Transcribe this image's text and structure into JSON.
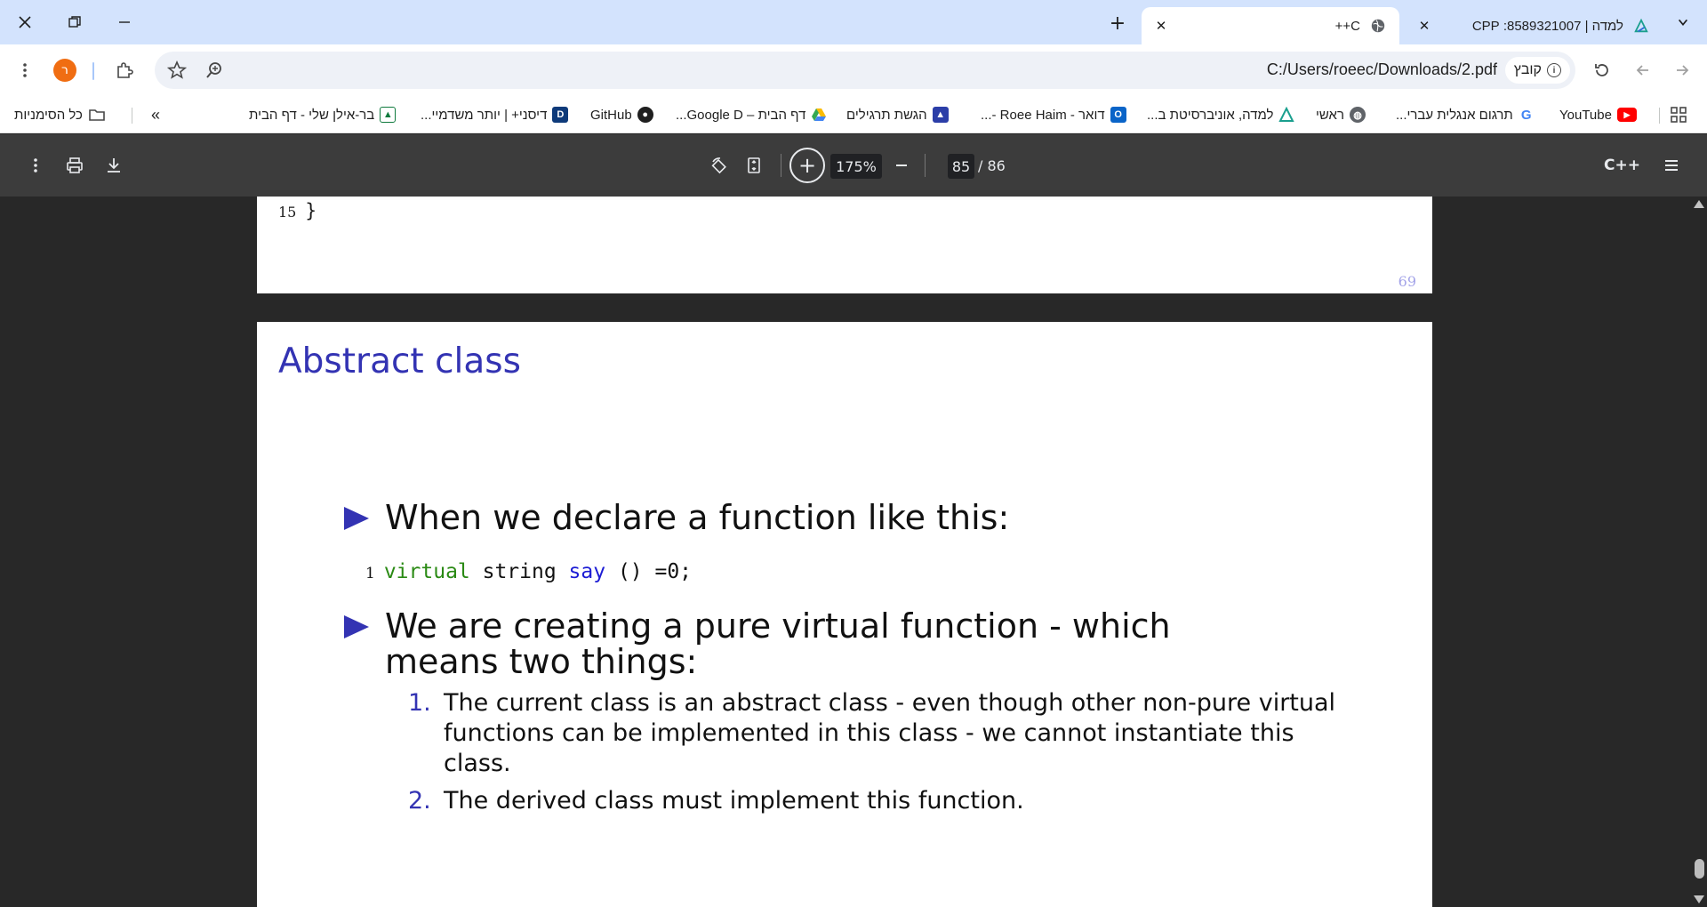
{
  "tabs": [
    {
      "title": "C++",
      "active": true,
      "icon": "globe-icon"
    },
    {
      "title": "למדה | 8589321007: CPP",
      "active": false,
      "icon": "lemida-logo-icon"
    }
  ],
  "toolbar": {
    "profile_initial": "ר",
    "url": "C:/Users/roeec/Downloads/2.pdf",
    "file_chip_label": "קובץ"
  },
  "bookmarks": [
    {
      "label": "YouTube",
      "icon": "youtube-icon",
      "color": "#ff0000"
    },
    {
      "label": "תרגום אנגלית עברי...",
      "icon": "google-icon",
      "color": "#4285f4"
    },
    {
      "label": "ראשי",
      "icon": "globe-icon",
      "color": "#5f6368"
    },
    {
      "label": "למדה, אוניברסיטת ב...",
      "icon": "lemida-logo-icon",
      "color": "#1a9f8e"
    },
    {
      "label": "דואר - Roee Haim -...",
      "icon": "outlook-icon",
      "color": "#0a64c8"
    },
    {
      "label": "הגשת תרגילים",
      "icon": "submission-icon",
      "color": "#2b3ea8"
    },
    {
      "label": "דף הבית – Google D...",
      "icon": "google-drive-icon",
      "color": "#34a853"
    },
    {
      "label": "GitHub",
      "icon": "github-icon",
      "color": "#1f1f1f"
    },
    {
      "label": "דיסני+ | יותר משדמיי...",
      "icon": "disney-plus-icon",
      "color": "#0e3a7a"
    },
    {
      "label": "בר-אילן שלי - דף הבית",
      "icon": "bar-ilan-icon",
      "color": "#0f7a3d"
    }
  ],
  "all_bookmarks_label": "כל הסימניות",
  "pdf": {
    "zoom": "175%",
    "current_page": "85",
    "total_pages": "/  86",
    "title": "C++"
  },
  "prev_page": {
    "code_line_number": "15",
    "code_text": "}",
    "page_number": "69"
  },
  "slide": {
    "title": "Abstract class",
    "bullet1": "When we declare a function like this:",
    "code_line_number": "1",
    "code_kw1": "virtual",
    "code_type": " string ",
    "code_name": "say",
    "code_rest": " () =0;",
    "bullet2": "We are creating a pure virtual function - which means two things:",
    "items": [
      {
        "num": "1.",
        "text": "The current class is an abstract class - even though other non-pure virtual functions can be implemented in this class - we cannot instantiate this class."
      },
      {
        "num": "2.",
        "text": "The derived class must implement this function."
      }
    ]
  }
}
